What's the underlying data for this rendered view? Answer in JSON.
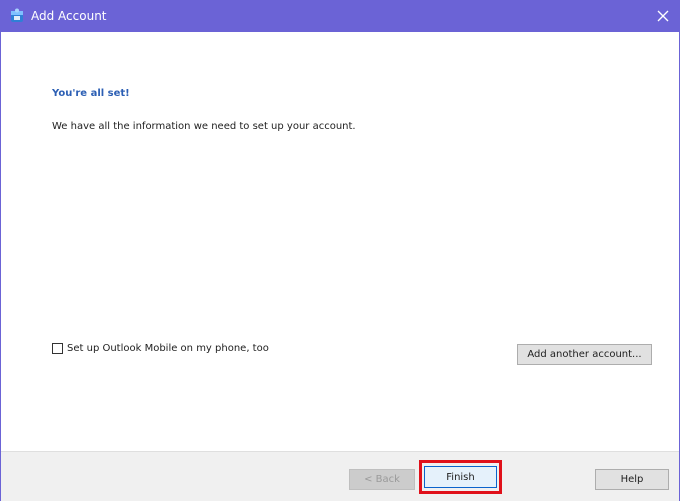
{
  "window": {
    "title": "Add Account",
    "accent_color": "#6b63d6",
    "icons": {
      "app": "outlook-icon",
      "close": "close-icon"
    }
  },
  "content": {
    "heading": "You're all set!",
    "info": "We have all the information we need to set up your account.",
    "mobile_checkbox": {
      "label": "Set up Outlook Mobile on my phone, too",
      "checked": false
    },
    "add_another_label": "Add another account..."
  },
  "footer": {
    "back_label": "< Back",
    "finish_label": "Finish",
    "help_label": "Help",
    "highlight_color": "#e0101a"
  }
}
